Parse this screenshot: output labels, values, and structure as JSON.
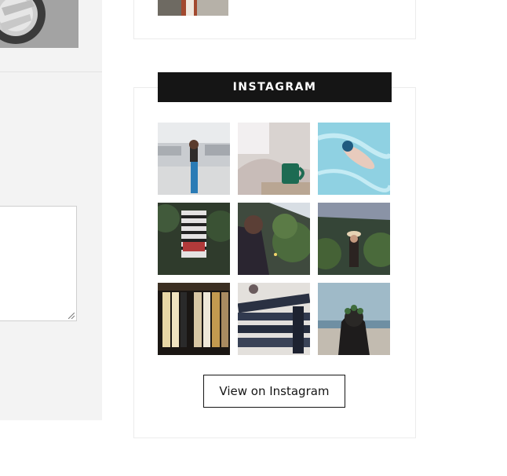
{
  "instagram": {
    "title": "INSTAGRAM",
    "button_label": "View on Instagram",
    "tiles": [
      {
        "subject": "woman-by-water"
      },
      {
        "subject": "coffee-cup-on-bed"
      },
      {
        "subject": "swimmer-in-pool"
      },
      {
        "subject": "woman-striped-dress"
      },
      {
        "subject": "woman-in-greenhouse-plants"
      },
      {
        "subject": "woman-in-greenhouse-hat"
      },
      {
        "subject": "clothing-rack"
      },
      {
        "subject": "makeup-brushes"
      },
      {
        "subject": "girl-flower-crown-beach"
      }
    ]
  },
  "colors": {
    "title_bar_bg": "#151515",
    "title_text": "#ffffff",
    "left_panel_bg": "#f3f3f3",
    "widget_border": "#ececec"
  },
  "icons": [
    "resize-handle-icon"
  ]
}
